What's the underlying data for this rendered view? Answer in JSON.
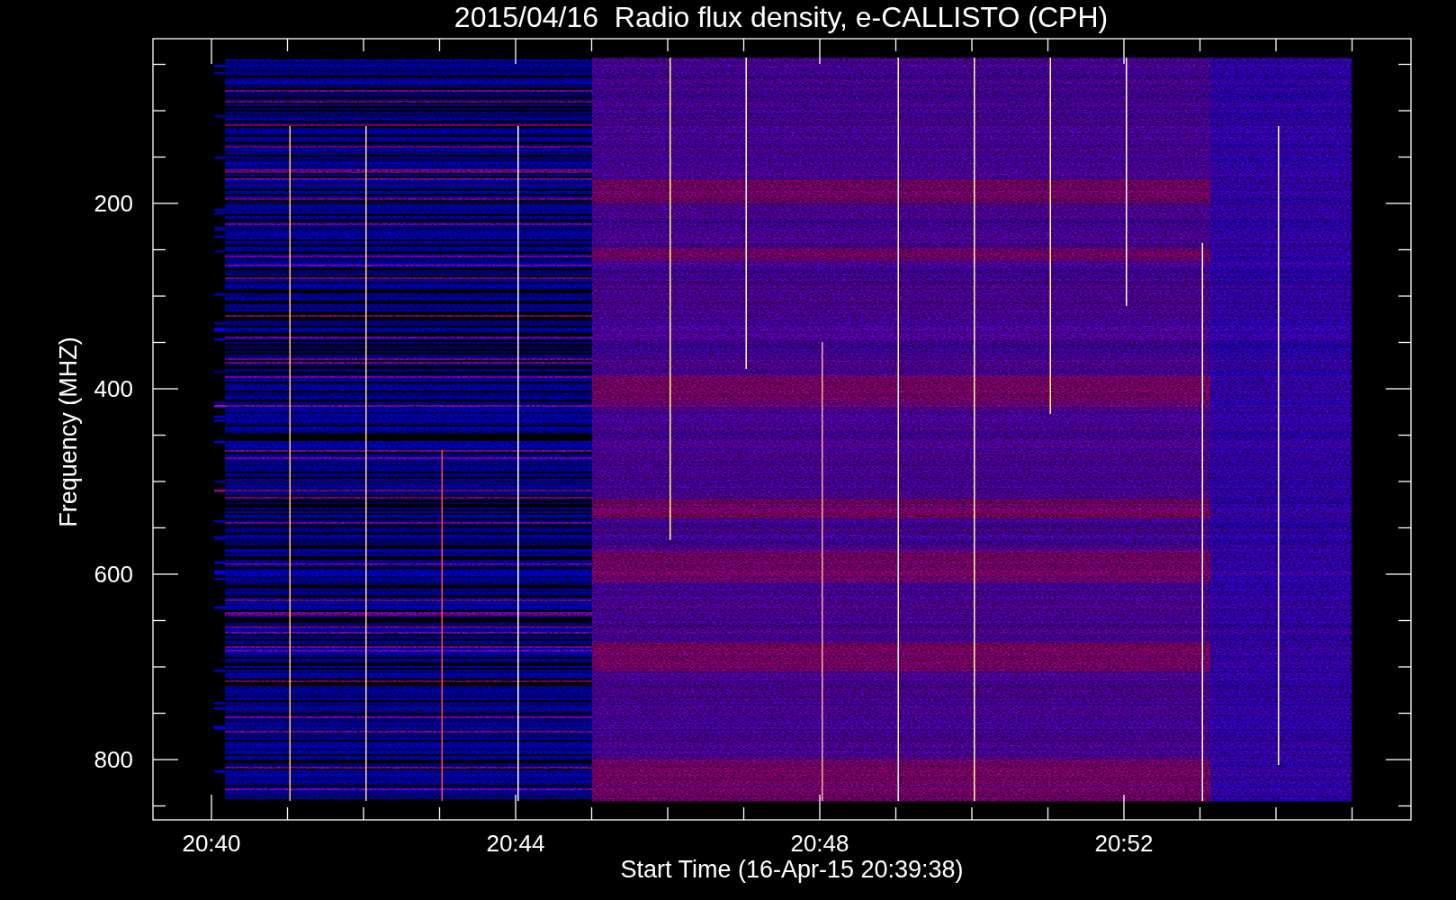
{
  "title": "2015/04/16  Radio flux density, e-CALLISTO (CPH)",
  "y_axis": {
    "label": "Frequency (MHZ)",
    "ticks": [
      "200",
      "400",
      "600",
      "800"
    ]
  },
  "x_axis": {
    "label": "Start Time (16-Apr-15 20:39:38)",
    "ticks": [
      "20:40",
      "20:44",
      "20:48",
      "20:52"
    ]
  }
}
